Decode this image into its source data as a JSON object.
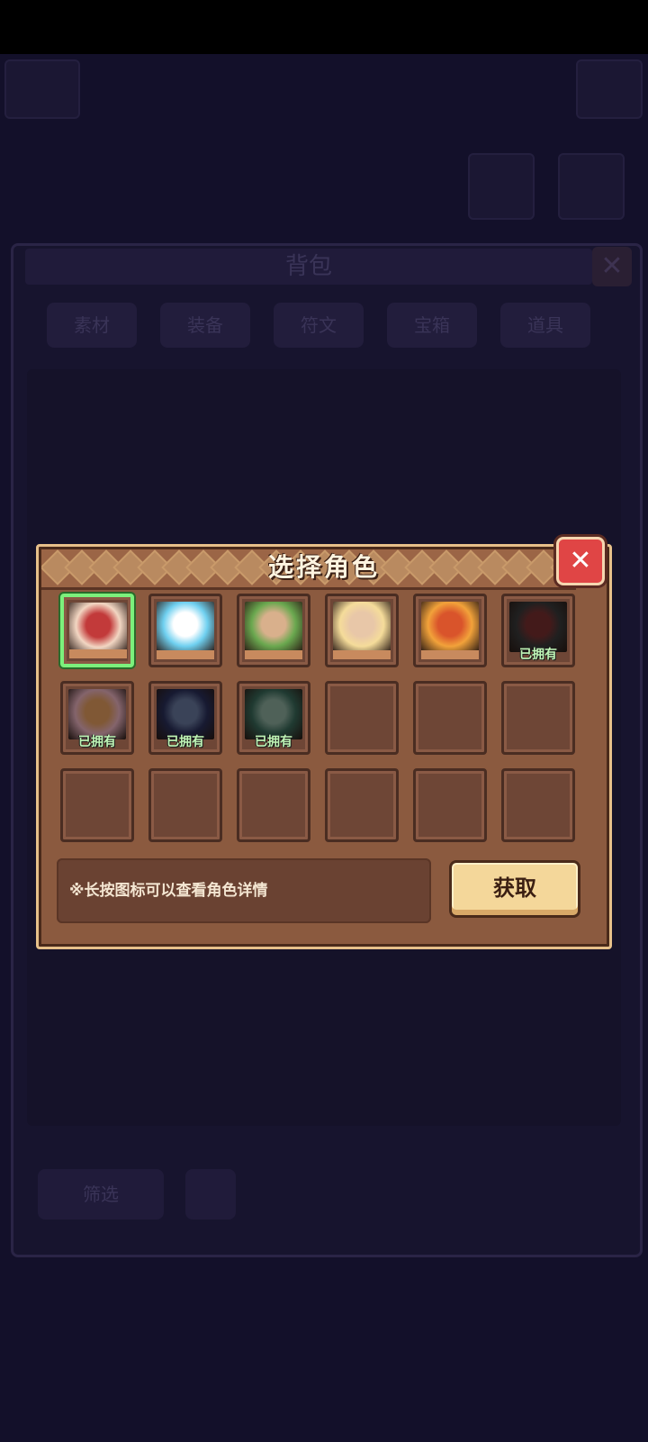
{
  "background": {
    "bag_title": "背包",
    "bag_tabs": [
      "素材",
      "装备",
      "符文",
      "宝箱",
      "道具"
    ],
    "filter_label": "筛选"
  },
  "modal": {
    "title": "选择角色",
    "close_icon": "close-icon",
    "hint": "※长按图标可以查看角色详情",
    "get_button": "获取",
    "owned_label": "已拥有",
    "characters": [
      {
        "owned": false,
        "selected": true,
        "colors": [
          "#f2d6c2",
          "#c23a3a"
        ]
      },
      {
        "owned": false,
        "selected": false,
        "colors": [
          "#6fd0f0",
          "#ffffff"
        ]
      },
      {
        "owned": false,
        "selected": false,
        "colors": [
          "#6aa84f",
          "#d9b08c"
        ]
      },
      {
        "owned": false,
        "selected": false,
        "colors": [
          "#f5dc9a",
          "#e8c7a8"
        ]
      },
      {
        "owned": false,
        "selected": false,
        "colors": [
          "#f2a23a",
          "#d9542b"
        ]
      },
      {
        "owned": true,
        "selected": false,
        "colors": [
          "#3a3a3a",
          "#7a3030"
        ]
      },
      {
        "owned": true,
        "selected": false,
        "colors": [
          "#f0b6c4",
          "#e8a060"
        ]
      },
      {
        "owned": true,
        "selected": false,
        "colors": [
          "#2a2f5a",
          "#6a7aa0"
        ]
      },
      {
        "owned": true,
        "selected": false,
        "colors": [
          "#3a6a5a",
          "#8fb0a0"
        ]
      }
    ],
    "empty_slots": 9
  }
}
